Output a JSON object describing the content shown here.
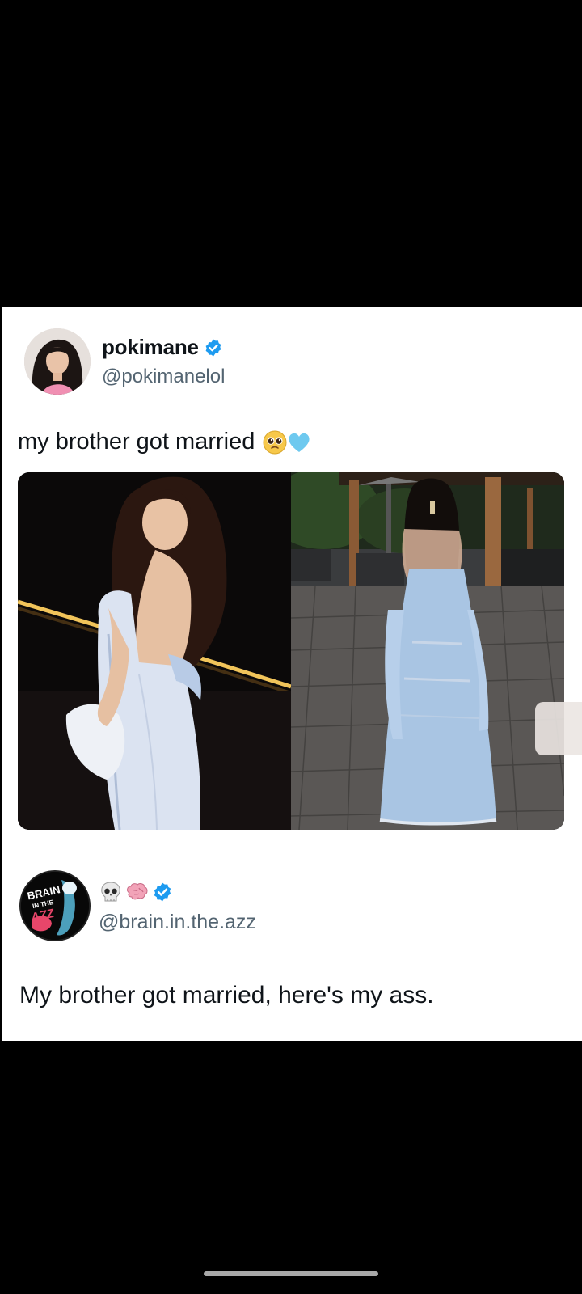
{
  "post1": {
    "display_name": "pokimane",
    "handle": "@pokimanelol",
    "text": "my brother got married",
    "verified": true,
    "emojis": [
      "pleading-face-emoji",
      "light-blue-heart-emoji"
    ],
    "media": [
      "photo-front-night",
      "photo-back-patio"
    ]
  },
  "post2": {
    "name_emojis": [
      "skull-emoji",
      "brain-emoji"
    ],
    "verified": true,
    "handle": "@brain.in.the.azz",
    "avatar_text": [
      "BRAIN",
      "IN THE",
      "AZZ"
    ],
    "text": "My brother got married, here's my ass."
  },
  "colors": {
    "verified_blue": "#1d9bf0",
    "dress_blue": "#a9c5e3",
    "text_primary": "#0f1419",
    "text_secondary": "#536471"
  }
}
